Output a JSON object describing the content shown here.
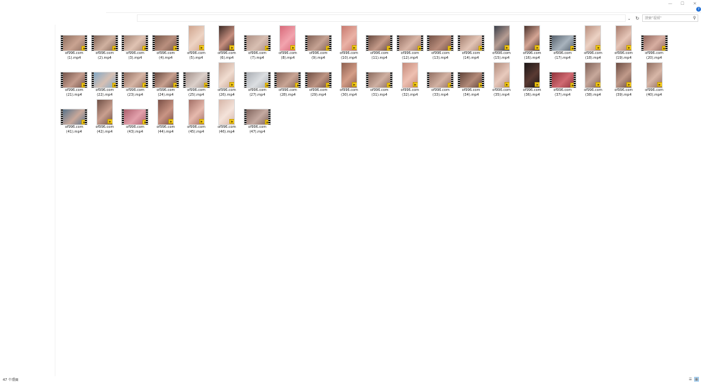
{
  "window": {
    "minimize_glyph": "—",
    "maximize_glyph": "☐",
    "close_glyph": "✕",
    "help_glyph": "?"
  },
  "toolbar": {
    "dropdown_glyph": "⌄",
    "refresh_glyph": "↻",
    "search_placeholder": "搜索\"视频\"",
    "search_glyph": "⚲"
  },
  "files": [
    {
      "line1": "of996.com",
      "line2": "(1).mp4",
      "orientation": "landscape",
      "colors": [
        "#8a6b5c",
        "#c9a391"
      ]
    },
    {
      "line1": "of996.com",
      "line2": "(2).mp4",
      "orientation": "landscape",
      "colors": [
        "#7d5f52",
        "#d0b1a0"
      ]
    },
    {
      "line1": "of996.com",
      "line2": "(3).mp4",
      "orientation": "landscape",
      "colors": [
        "#9b7c6d",
        "#e0c3b3"
      ]
    },
    {
      "line1": "of996.com",
      "line2": "(4).mp4",
      "orientation": "landscape",
      "colors": [
        "#6f5143",
        "#b98f7e"
      ]
    },
    {
      "line1": "of996.com",
      "line2": "(5).mp4",
      "orientation": "portrait",
      "colors": [
        "#cfa58f",
        "#eed4c4"
      ]
    },
    {
      "line1": "of996.com",
      "line2": "(6).mp4",
      "orientation": "portrait",
      "colors": [
        "#3c2a25",
        "#c78f7f"
      ]
    },
    {
      "line1": "of996.com",
      "line2": "(7).mp4",
      "orientation": "landscape",
      "colors": [
        "#a98b80",
        "#d8bfb2"
      ]
    },
    {
      "line1": "of996.com",
      "line2": "(8).mp4",
      "orientation": "portrait",
      "colors": [
        "#d86a7a",
        "#f2a4ae"
      ]
    },
    {
      "line1": "of996.com",
      "line2": "(9).mp4",
      "orientation": "landscape",
      "colors": [
        "#7a5a4e",
        "#c5a293"
      ]
    },
    {
      "line1": "of996.com",
      "line2": "(10).mp4",
      "orientation": "portrait",
      "colors": [
        "#c77a6f",
        "#eab2a6"
      ]
    },
    {
      "line1": "of996.com",
      "line2": "(11).mp4",
      "orientation": "landscape",
      "colors": [
        "#5e4238",
        "#c49a89"
      ]
    },
    {
      "line1": "of996.com",
      "line2": "(12).mp4",
      "orientation": "landscape",
      "colors": [
        "#8f6a5d",
        "#d9b6a7"
      ]
    },
    {
      "line1": "of996.com",
      "line2": "(13).mp4",
      "orientation": "landscape",
      "colors": [
        "#6d4d42",
        "#b98d7c"
      ]
    },
    {
      "line1": "of996.com",
      "line2": "(14).mp4",
      "orientation": "landscape",
      "colors": [
        "#9e7a6a",
        "#e3c5b6"
      ]
    },
    {
      "line1": "of996.com",
      "line2": "(15).mp4",
      "orientation": "portrait",
      "colors": [
        "#3a3f4a",
        "#b69c92"
      ]
    },
    {
      "line1": "of996.com",
      "line2": "(16).mp4",
      "orientation": "portrait",
      "colors": [
        "#4a322c",
        "#d4a594"
      ]
    },
    {
      "line1": "of996.com",
      "line2": "(17).mp4",
      "orientation": "landscape",
      "colors": [
        "#4f5a66",
        "#a8b3bd"
      ]
    },
    {
      "line1": "of996.com",
      "line2": "(18).mp4",
      "orientation": "portrait",
      "colors": [
        "#b98f7e",
        "#ecd2c4"
      ]
    },
    {
      "line1": "of996.com",
      "line2": "(19).mp4",
      "orientation": "portrait",
      "colors": [
        "#a77b6c",
        "#e6c6b8"
      ]
    },
    {
      "line1": "of996.com",
      "line2": "(20).mp4",
      "orientation": "landscape",
      "colors": [
        "#8a5f56",
        "#d7aea1"
      ]
    },
    {
      "line1": "of996.com",
      "line2": "(21).mp4",
      "orientation": "landscape",
      "colors": [
        "#6e4f46",
        "#c39b8c"
      ]
    },
    {
      "line1": "of996.com",
      "line2": "(22).mp4",
      "orientation": "landscape",
      "colors": [
        "#7aa6c8",
        "#d6c0b4"
      ]
    },
    {
      "line1": "of996.com",
      "line2": "(23).mp4",
      "orientation": "landscape",
      "colors": [
        "#8c6a5d",
        "#d6b5a5"
      ]
    },
    {
      "line1": "of996.com",
      "line2": "(24).mp4",
      "orientation": "landscape",
      "colors": [
        "#5d4037",
        "#c8a08f"
      ]
    },
    {
      "line1": "of996.com",
      "line2": "(25).mp4",
      "orientation": "landscape",
      "colors": [
        "#9c8a84",
        "#dcd0ca"
      ]
    },
    {
      "line1": "of996.com",
      "line2": "(26).mp4",
      "orientation": "portrait",
      "colors": [
        "#c6a596",
        "#f0dcd0"
      ]
    },
    {
      "line1": "of996.com",
      "line2": "(27).mp4",
      "orientation": "landscape",
      "colors": [
        "#a4a8ae",
        "#dcdfe2"
      ]
    },
    {
      "line1": "of996.com",
      "line2": "(28).mp4",
      "orientation": "landscape",
      "colors": [
        "#7c5c51",
        "#c9a595"
      ]
    },
    {
      "line1": "of996.com",
      "line2": "(29).mp4",
      "orientation": "landscape",
      "colors": [
        "#6a4a40",
        "#bd9483"
      ]
    },
    {
      "line1": "of996.com",
      "line2": "(30).mp4",
      "orientation": "portrait",
      "colors": [
        "#8d5f4f",
        "#d49e88"
      ]
    },
    {
      "line1": "of996.com",
      "line2": "(31).mp4",
      "orientation": "landscape",
      "colors": [
        "#846559",
        "#cfb0a2"
      ]
    },
    {
      "line1": "of996.com",
      "line2": "(32).mp4",
      "orientation": "portrait",
      "colors": [
        "#c48a7a",
        "#eec0b2"
      ]
    },
    {
      "line1": "of996.com",
      "line2": "(33).mp4",
      "orientation": "landscape",
      "colors": [
        "#8b6a5e",
        "#d3b2a3"
      ]
    },
    {
      "line1": "of996.com",
      "line2": "(34).mp4",
      "orientation": "landscape",
      "colors": [
        "#5a3f36",
        "#b28a79"
      ]
    },
    {
      "line1": "of996.com",
      "line2": "(35).mp4",
      "orientation": "portrait",
      "colors": [
        "#b08b7c",
        "#e8cabd"
      ]
    },
    {
      "line1": "of996.com",
      "line2": "(36).mp4",
      "orientation": "portrait",
      "colors": [
        "#1b1616",
        "#5a3a33"
      ]
    },
    {
      "line1": "of996.com",
      "line2": "(37).mp4",
      "orientation": "landscape",
      "colors": [
        "#8a2f36",
        "#d06a72"
      ]
    },
    {
      "line1": "of996.com",
      "line2": "(38).mp4",
      "orientation": "portrait",
      "colors": [
        "#7e6157",
        "#c7a89b"
      ]
    },
    {
      "line1": "of996.com",
      "line2": "(39).mp4",
      "orientation": "portrait",
      "colors": [
        "#6b4c42",
        "#c09a8a"
      ]
    },
    {
      "line1": "of996.com",
      "line2": "(40).mp4",
      "orientation": "portrait",
      "colors": [
        "#8f6d60",
        "#d8b7a8"
      ]
    },
    {
      "line1": "of996.com",
      "line2": "(41).mp4",
      "orientation": "landscape",
      "colors": [
        "#4e6f8a",
        "#c9a89a"
      ]
    },
    {
      "line1": "of996.com",
      "line2": "(42).mp4",
      "orientation": "portrait",
      "colors": [
        "#6f4f45",
        "#c99f8f"
      ]
    },
    {
      "line1": "of996.com",
      "line2": "(43).mp4",
      "orientation": "landscape",
      "colors": [
        "#a85a68",
        "#e2a0ab"
      ]
    },
    {
      "line1": "of996.com",
      "line2": "(44).mp4",
      "orientation": "portrait",
      "colors": [
        "#7a4f45",
        "#c99484"
      ]
    },
    {
      "line1": "of996.com",
      "line2": "(45).mp4",
      "orientation": "portrait",
      "colors": [
        "#a36f66",
        "#e6b9ad"
      ]
    },
    {
      "line1": "of996.com",
      "line2": "(46).mp4",
      "orientation": "portrait",
      "colors": [
        "#d7b6a8",
        "#f4e3da"
      ]
    },
    {
      "line1": "of996.com",
      "line2": "(47).mp4",
      "orientation": "landscape",
      "colors": [
        "#7a5e57",
        "#c4a9a0"
      ]
    }
  ],
  "badge_glyph": "▶",
  "status": {
    "item_count": "47 个项目",
    "details_view_glyph": "☰",
    "thumbnail_view_glyph": "▦"
  },
  "colors": {
    "badge_bg": "#f3c81b",
    "help_blue": "#1f6fd6",
    "selection_blue": "#cce4f7"
  }
}
